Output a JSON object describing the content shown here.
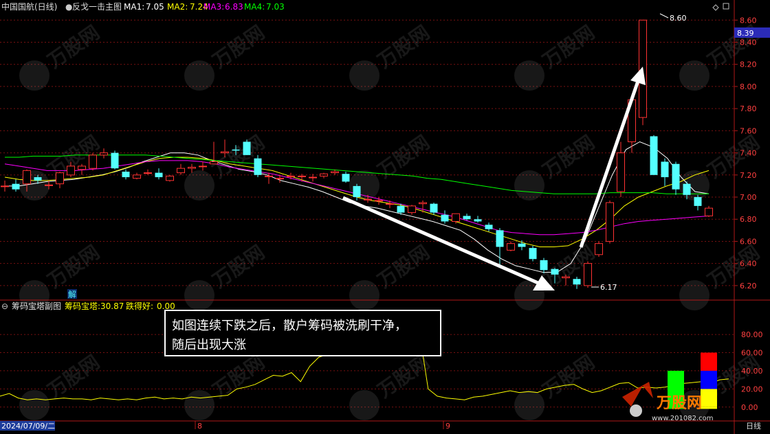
{
  "main_panel": {
    "stock_name": "中国国航",
    "period": "(日线)",
    "indicator": "反戈一击主图",
    "ma": [
      {
        "label": "MA1:",
        "value": "7.05",
        "color": "#ffffff"
      },
      {
        "label": "MA2:",
        "value": "7.24",
        "color": "#ffff00"
      },
      {
        "label": "MA3:",
        "value": "6.83",
        "color": "#ff00ff"
      },
      {
        "label": "MA4:",
        "value": "7.03",
        "color": "#00ff00"
      }
    ],
    "price_box": "8.39",
    "high_label": "8.60",
    "low_label": "6.17",
    "marker_label": "解"
  },
  "sub_panel": {
    "title": "筹码宝塔副图",
    "item1_label": "筹码宝塔:",
    "item1_value": "30.87",
    "item2_label": "跌得好:",
    "item2_value": "0.00"
  },
  "annotation": {
    "line1": "如图连续下跌之后，散户筹码被洗刷干净，",
    "line2": "随后出现大涨"
  },
  "bottom_bar": {
    "date": "2024/07/09/二",
    "month_8": "8",
    "month_9": "9",
    "period_tab": "日线"
  },
  "watermark": {
    "name": "万股网",
    "url": "www.201082.com"
  },
  "colors": {
    "up": "#ff3232",
    "down": "#54ffff",
    "grid": "#7a1010",
    "axis_text": "#ff4040",
    "ma1": "#ffffff",
    "ma2": "#ffff00",
    "ma3": "#ff00ff",
    "ma4": "#00ff00"
  },
  "chart_data": [
    {
      "type": "candlestick",
      "title": "中国国航 (日线)",
      "ylim": [
        6.1,
        8.67
      ],
      "y_ticks": [
        6.2,
        6.4,
        6.6,
        6.8,
        7.0,
        7.2,
        7.4,
        7.6,
        7.8,
        8.0,
        8.2,
        8.4,
        8.6
      ],
      "x_month_labels": [
        "8",
        "9"
      ],
      "candles": [
        {
          "o": 7.1,
          "h": 7.15,
          "l": 7.05,
          "c": 7.1
        },
        {
          "o": 7.12,
          "h": 7.16,
          "l": 7.05,
          "c": 7.07
        },
        {
          "o": 7.12,
          "h": 7.25,
          "l": 7.05,
          "c": 7.24
        },
        {
          "o": 7.18,
          "h": 7.2,
          "l": 7.12,
          "c": 7.15
        },
        {
          "o": 7.11,
          "h": 7.15,
          "l": 7.07,
          "c": 7.11
        },
        {
          "o": 7.12,
          "h": 7.23,
          "l": 7.08,
          "c": 7.22
        },
        {
          "o": 7.2,
          "h": 7.32,
          "l": 7.18,
          "c": 7.28
        },
        {
          "o": 7.25,
          "h": 7.3,
          "l": 7.2,
          "c": 7.28
        },
        {
          "o": 7.26,
          "h": 7.4,
          "l": 7.24,
          "c": 7.38
        },
        {
          "o": 7.38,
          "h": 7.44,
          "l": 7.35,
          "c": 7.4
        },
        {
          "o": 7.4,
          "h": 7.42,
          "l": 7.25,
          "c": 7.26
        },
        {
          "o": 7.23,
          "h": 7.25,
          "l": 7.16,
          "c": 7.18
        },
        {
          "o": 7.17,
          "h": 7.22,
          "l": 7.16,
          "c": 7.2
        },
        {
          "o": 7.22,
          "h": 7.25,
          "l": 7.2,
          "c": 7.22
        },
        {
          "o": 7.22,
          "h": 7.26,
          "l": 7.16,
          "c": 7.18
        },
        {
          "o": 7.15,
          "h": 7.2,
          "l": 7.14,
          "c": 7.19
        },
        {
          "o": 7.22,
          "h": 7.3,
          "l": 7.2,
          "c": 7.26
        },
        {
          "o": 7.26,
          "h": 7.3,
          "l": 7.22,
          "c": 7.27
        },
        {
          "o": 7.28,
          "h": 7.32,
          "l": 7.24,
          "c": 7.28
        },
        {
          "o": 7.3,
          "h": 7.5,
          "l": 7.3,
          "c": 7.32
        },
        {
          "o": 7.4,
          "h": 7.52,
          "l": 7.36,
          "c": 7.41
        },
        {
          "o": 7.43,
          "h": 7.47,
          "l": 7.38,
          "c": 7.42
        },
        {
          "o": 7.5,
          "h": 7.52,
          "l": 7.38,
          "c": 7.38
        },
        {
          "o": 7.35,
          "h": 7.38,
          "l": 7.18,
          "c": 7.2
        },
        {
          "o": 7.19,
          "h": 7.22,
          "l": 7.12,
          "c": 7.19
        },
        {
          "o": 7.17,
          "h": 7.2,
          "l": 7.13,
          "c": 7.17
        },
        {
          "o": 7.19,
          "h": 7.22,
          "l": 7.16,
          "c": 7.19
        },
        {
          "o": 7.19,
          "h": 7.21,
          "l": 7.14,
          "c": 7.19
        },
        {
          "o": 7.18,
          "h": 7.21,
          "l": 7.14,
          "c": 7.18
        },
        {
          "o": 7.19,
          "h": 7.22,
          "l": 7.17,
          "c": 7.21
        },
        {
          "o": 7.22,
          "h": 7.25,
          "l": 7.2,
          "c": 7.23
        },
        {
          "o": 7.21,
          "h": 7.23,
          "l": 7.13,
          "c": 7.14
        },
        {
          "o": 7.1,
          "h": 7.12,
          "l": 6.97,
          "c": 7.0
        },
        {
          "o": 6.98,
          "h": 7.02,
          "l": 6.95,
          "c": 6.98
        },
        {
          "o": 6.97,
          "h": 7.0,
          "l": 6.93,
          "c": 6.97
        },
        {
          "o": 6.94,
          "h": 6.97,
          "l": 6.9,
          "c": 6.94
        },
        {
          "o": 6.92,
          "h": 6.94,
          "l": 6.84,
          "c": 6.86
        },
        {
          "o": 6.86,
          "h": 6.93,
          "l": 6.84,
          "c": 6.92
        },
        {
          "o": 6.94,
          "h": 6.97,
          "l": 6.86,
          "c": 6.95
        },
        {
          "o": 6.94,
          "h": 6.95,
          "l": 6.84,
          "c": 6.86
        },
        {
          "o": 6.84,
          "h": 6.88,
          "l": 6.76,
          "c": 6.78
        },
        {
          "o": 6.78,
          "h": 6.85,
          "l": 6.76,
          "c": 6.85
        },
        {
          "o": 6.83,
          "h": 6.85,
          "l": 6.79,
          "c": 6.8
        },
        {
          "o": 6.8,
          "h": 6.83,
          "l": 6.77,
          "c": 6.78
        },
        {
          "o": 6.75,
          "h": 6.77,
          "l": 6.69,
          "c": 6.71
        },
        {
          "o": 6.7,
          "h": 6.72,
          "l": 6.38,
          "c": 6.55
        },
        {
          "o": 6.52,
          "h": 6.6,
          "l": 6.51,
          "c": 6.58
        },
        {
          "o": 6.58,
          "h": 6.61,
          "l": 6.52,
          "c": 6.55
        },
        {
          "o": 6.54,
          "h": 6.56,
          "l": 6.42,
          "c": 6.44
        },
        {
          "o": 6.43,
          "h": 6.45,
          "l": 6.31,
          "c": 6.34
        },
        {
          "o": 6.35,
          "h": 6.36,
          "l": 6.22,
          "c": 6.3
        },
        {
          "o": 6.27,
          "h": 6.3,
          "l": 6.2,
          "c": 6.28
        },
        {
          "o": 6.26,
          "h": 6.28,
          "l": 6.17,
          "c": 6.21
        },
        {
          "o": 6.2,
          "h": 6.42,
          "l": 6.18,
          "c": 6.4
        },
        {
          "o": 6.48,
          "h": 6.6,
          "l": 6.46,
          "c": 6.58
        },
        {
          "o": 6.6,
          "h": 6.97,
          "l": 6.58,
          "c": 6.95
        },
        {
          "o": 7.05,
          "h": 7.5,
          "l": 7.0,
          "c": 7.4
        },
        {
          "o": 7.5,
          "h": 7.92,
          "l": 7.4,
          "c": 7.88
        },
        {
          "o": 7.72,
          "h": 8.6,
          "l": 7.65,
          "c": 8.6
        },
        {
          "o": 7.55,
          "h": 7.56,
          "l": 7.28,
          "c": 7.2
        },
        {
          "o": 7.32,
          "h": 7.35,
          "l": 7.1,
          "c": 7.18
        },
        {
          "o": 7.3,
          "h": 7.32,
          "l": 7.02,
          "c": 7.07
        },
        {
          "o": 7.12,
          "h": 7.14,
          "l": 6.98,
          "c": 7.02
        },
        {
          "o": 7.0,
          "h": 7.02,
          "l": 6.88,
          "c": 6.92
        },
        {
          "o": 6.83,
          "h": 6.92,
          "l": 6.82,
          "c": 6.9
        }
      ],
      "ma_lines": [
        {
          "name": "MA1",
          "color": "#ffffff",
          "values": [
            7.1,
            7.1,
            7.12,
            7.14,
            7.15,
            7.16,
            7.18,
            7.2,
            7.23,
            7.27,
            7.32,
            7.36,
            7.4,
            7.4,
            7.38,
            7.33,
            7.29,
            7.25,
            7.23,
            7.2,
            7.15,
            7.12,
            7.09,
            7.05,
            7.0,
            6.95,
            6.92,
            6.9,
            6.87,
            6.84,
            6.81,
            6.78,
            6.74,
            6.7,
            6.62,
            6.52,
            6.44,
            6.38,
            6.35,
            6.32,
            6.32,
            6.4,
            6.6,
            6.9,
            7.2,
            7.43,
            7.5,
            7.45,
            7.35,
            7.18,
            7.05,
            7.03
          ]
        },
        {
          "name": "MA2",
          "color": "#ffff00",
          "values": [
            7.18,
            7.16,
            7.15,
            7.15,
            7.16,
            7.17,
            7.18,
            7.2,
            7.24,
            7.28,
            7.32,
            7.35,
            7.36,
            7.36,
            7.35,
            7.33,
            7.3,
            7.28,
            7.26,
            7.24,
            7.2,
            7.16,
            7.12,
            7.08,
            7.04,
            7.0,
            6.97,
            6.95,
            6.93,
            6.9,
            6.86,
            6.82,
            6.78,
            6.74,
            6.7,
            6.66,
            6.62,
            6.58,
            6.55,
            6.55,
            6.56,
            6.62,
            6.7,
            6.8,
            6.92,
            7.0,
            7.05,
            7.1,
            7.14,
            7.2,
            7.24
          ]
        },
        {
          "name": "MA3",
          "color": "#ff00ff",
          "values": [
            7.3,
            7.28,
            7.26,
            7.24,
            7.24,
            7.24,
            7.25,
            7.26,
            7.28,
            7.3,
            7.32,
            7.33,
            7.33,
            7.33,
            7.32,
            7.3,
            7.27,
            7.25,
            7.23,
            7.21,
            7.18,
            7.15,
            7.12,
            7.09,
            7.06,
            7.03,
            7.0,
            6.97,
            6.94,
            6.91,
            6.88,
            6.85,
            6.82,
            6.78,
            6.74,
            6.7,
            6.68,
            6.67,
            6.66,
            6.66,
            6.67,
            6.68,
            6.7,
            6.73,
            6.76,
            6.78,
            6.79,
            6.8,
            6.81,
            6.82,
            6.83
          ]
        },
        {
          "name": "MA4",
          "color": "#00ff00",
          "values": [
            7.36,
            7.36,
            7.37,
            7.37,
            7.37,
            7.38,
            7.38,
            7.38,
            7.38,
            7.38,
            7.38,
            7.37,
            7.36,
            7.35,
            7.34,
            7.33,
            7.32,
            7.31,
            7.3,
            7.29,
            7.28,
            7.27,
            7.26,
            7.25,
            7.24,
            7.23,
            7.22,
            7.21,
            7.2,
            7.19,
            7.17,
            7.16,
            7.14,
            7.12,
            7.1,
            7.08,
            7.06,
            7.05,
            7.04,
            7.03,
            7.03,
            7.03,
            7.03,
            7.04,
            7.04,
            7.04,
            7.04,
            7.03,
            7.03,
            7.03,
            7.03
          ]
        }
      ]
    },
    {
      "type": "line",
      "title": "筹码宝塔副图",
      "ylim": [
        -10,
        102
      ],
      "y_ticks": [
        0.0,
        20.0,
        40.0,
        60.0,
        80.0
      ],
      "series": [
        {
          "name": "筹码宝塔",
          "color": "#ffff00",
          "values": [
            12,
            15,
            10,
            8,
            9,
            8,
            9,
            10,
            9,
            9,
            8,
            10,
            9,
            8,
            9,
            8,
            10,
            11,
            9,
            10,
            9,
            11,
            10,
            11,
            12,
            13,
            20,
            22,
            25,
            30,
            35,
            34,
            38,
            28,
            45,
            55,
            58,
            62,
            72,
            75,
            78,
            95,
            98,
            98,
            97,
            96,
            85,
            20,
            12,
            10,
            9,
            8,
            11,
            12,
            14,
            16,
            18,
            16,
            17,
            16,
            20,
            22,
            24,
            25,
            20,
            16,
            18,
            22,
            26,
            27,
            21,
            22,
            21,
            22,
            24,
            26,
            27,
            28,
            26,
            30,
            31
          ]
        }
      ],
      "bars": [
        {
          "x_index": 61,
          "segments": [
            {
              "from": -2,
              "to": 40,
              "color": "#00ff00"
            }
          ]
        },
        {
          "x_index": 64,
          "segments": [
            {
              "from": -2,
              "to": 0,
              "color": "#ffff00"
            },
            {
              "from": 0,
              "to": 20,
              "color": "#ffff00"
            },
            {
              "from": 20,
              "to": 40,
              "color": "#0000ff"
            },
            {
              "from": 40,
              "to": 60,
              "color": "#ff0000"
            }
          ]
        }
      ]
    }
  ]
}
